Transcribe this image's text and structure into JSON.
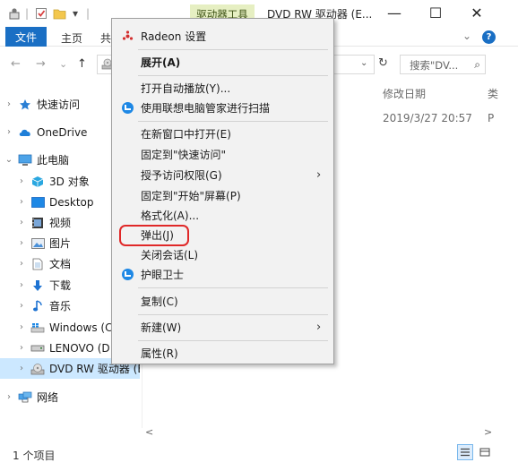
{
  "titlebar": {
    "context_tab": "驱动器工具",
    "window_title": "DVD RW 驱动器 (E...",
    "qa_dropdown": "▾",
    "qa_separator": "|",
    "minimize": "—",
    "maximize": "☐",
    "close": "✕"
  },
  "ribbon": {
    "file_tab": "文件",
    "home_tab": "主页",
    "share_tab": "共",
    "chevron": "⌄",
    "help": "?"
  },
  "address": {
    "back": "←",
    "forward": "→",
    "recent": "⌄",
    "up": "↑",
    "dropdown": "⌄",
    "refresh": "↻",
    "search_placeholder": "搜索\"DV...",
    "search_icon_glyph": "⌕"
  },
  "nav_pane": {
    "items": [
      {
        "label": "快速访问",
        "chev": "›",
        "icon": "star-icon"
      },
      {
        "label": "OneDrive",
        "chev": "›",
        "icon": "cloud-icon"
      },
      {
        "label": "此电脑",
        "chev": "⌄",
        "icon": "pc-icon"
      },
      {
        "label": "3D 对象",
        "chev": "›",
        "icon": "cube-icon"
      },
      {
        "label": "Desktop",
        "chev": "›",
        "icon": "desktop-icon"
      },
      {
        "label": "视频",
        "chev": "›",
        "icon": "video-icon"
      },
      {
        "label": "图片",
        "chev": "›",
        "icon": "picture-icon"
      },
      {
        "label": "文档",
        "chev": "›",
        "icon": "document-icon"
      },
      {
        "label": "下载",
        "chev": "›",
        "icon": "download-icon"
      },
      {
        "label": "音乐",
        "chev": "›",
        "icon": "music-icon"
      },
      {
        "label": "Windows (C:",
        "chev": "›",
        "icon": "windows-drive-icon"
      },
      {
        "label": "LENOVO (D:",
        "chev": "›",
        "icon": "drive-icon"
      },
      {
        "label": "DVD RW 驱动器 (E",
        "chev": "›",
        "icon": "dvd-drive-icon",
        "selected": true
      },
      {
        "label": "网络",
        "chev": "›",
        "icon": "network-icon"
      }
    ]
  },
  "file_list": {
    "columns": [
      "修改日期",
      "类"
    ],
    "rows": [
      {
        "date": "2019/3/27 20:57",
        "type": "P"
      }
    ]
  },
  "scrollbar": {
    "left": "<",
    "right": ">"
  },
  "status": {
    "item_count": "1 个项目"
  },
  "context_menu": {
    "items": [
      {
        "label": "Radeon 设置",
        "icon": "radeon-icon"
      },
      {
        "label": "展开(A)",
        "bold": true
      },
      {
        "label": "打开自动播放(Y)..."
      },
      {
        "label": "使用联想电脑管家进行扫描",
        "icon": "shield-icon"
      },
      {
        "label": "在新窗口中打开(E)"
      },
      {
        "label": "固定到\"快速访问\""
      },
      {
        "label": "授予访问权限(G)",
        "submenu": true
      },
      {
        "label": "固定到\"开始\"屏幕(P)"
      },
      {
        "label": "格式化(A)..."
      },
      {
        "label": "弹出(J)",
        "highlighted": true
      },
      {
        "label": "关闭会话(L)"
      },
      {
        "label": "护眼卫士",
        "icon": "shield-icon"
      },
      {
        "label": "复制(C)"
      },
      {
        "label": "新建(W)",
        "submenu": true
      },
      {
        "label": "属性(R)"
      }
    ],
    "submenu_glyph": "›"
  },
  "colors": {
    "accent": "#1a6fc4",
    "context_tab_bg": "#e6efc2",
    "selection": "#cce8ff",
    "highlight_ring": "#e02828"
  }
}
